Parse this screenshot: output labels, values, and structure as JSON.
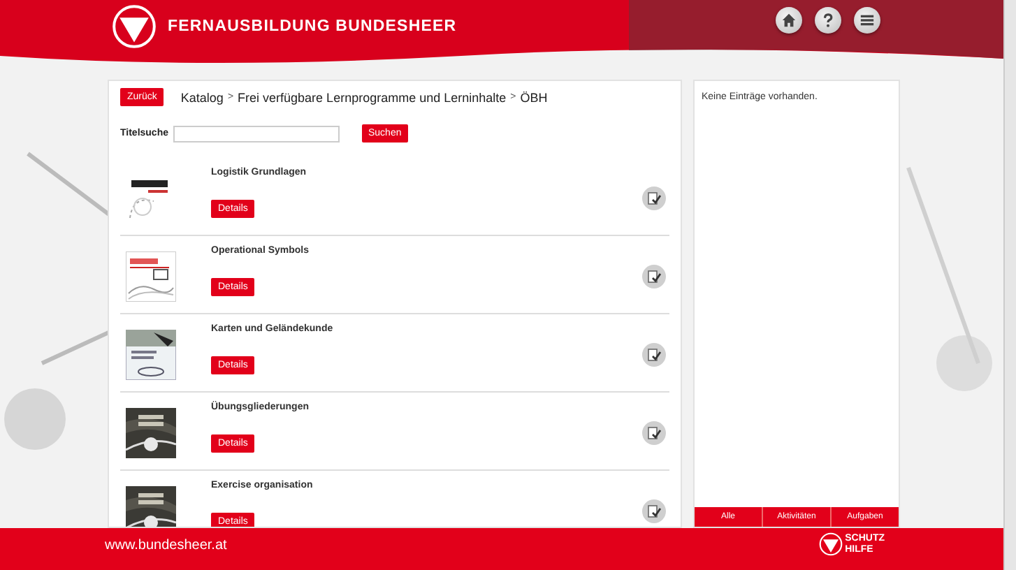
{
  "header": {
    "title": "FERNAUSBILDUNG BUNDESHEER",
    "actions": [
      {
        "kind": "home"
      },
      {
        "kind": "help"
      },
      {
        "kind": "menu"
      }
    ]
  },
  "catalog": {
    "back_button": "Zurück",
    "breadcrumb": [
      "Katalog",
      "Frei verfügbare Lernprogramme und Lerninhalte",
      "ÖBH"
    ],
    "separator": ">",
    "search": {
      "label": "Titelsuche",
      "button": "Suchen"
    },
    "items": [
      {
        "title": "Logistik Grundlagen",
        "button": "Details"
      },
      {
        "title": "Operational Symbols",
        "button": "Details"
      },
      {
        "title": "Karten und Geländekunde",
        "button": "Details"
      },
      {
        "title": "Übungsgliederungen",
        "button": "Details"
      },
      {
        "title": "Exercise organisation",
        "button": "Details"
      }
    ]
  },
  "side_panel": {
    "empty_text": "Keine Einträge vorhanden.",
    "tabs": [
      "Alle",
      "Aktivitäten",
      "Aufgaben"
    ]
  },
  "footer": {
    "link": "www.bundesheer.at",
    "logo_lines": [
      "SCHUTZ",
      "HILFE"
    ]
  }
}
